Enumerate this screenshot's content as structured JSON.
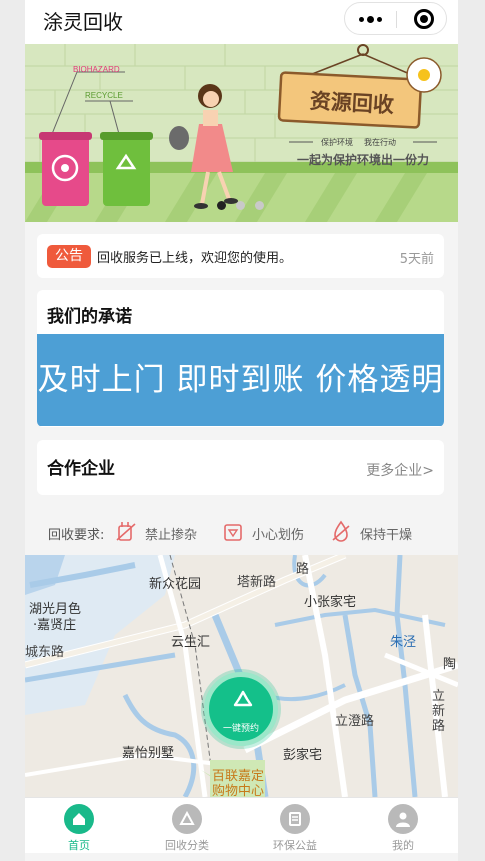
{
  "header": {
    "title": "涂灵回收",
    "menu_icon": "more-dots-icon",
    "close_icon": "capsule-close-icon"
  },
  "banner": {
    "bin_label_1": "BIOHAZARD",
    "bin_label_2": "RECYCLE",
    "sign_title": "资源回收",
    "sign_sub_1": "保护环境",
    "sign_sub_2": "我在行动",
    "slogan": "一起为保护环境出一份力",
    "slides_count": 3,
    "active_slide": 1
  },
  "notice": {
    "badge": "公告",
    "text": "回收服务已上线，欢迎您的使用。",
    "time": "5天前"
  },
  "promise": {
    "title": "我们的承诺",
    "banner_text": "及时上门  即时到账  价格透明"
  },
  "partners": {
    "title": "合作企业",
    "more": "更多企业>"
  },
  "requirements": {
    "label": "回收要求:",
    "items": [
      {
        "text": "禁止掺杂",
        "icon": "no-mix-icon"
      },
      {
        "text": "小心划伤",
        "icon": "cut-warning-icon"
      },
      {
        "text": "保持干燥",
        "icon": "keep-dry-icon"
      }
    ]
  },
  "map": {
    "labels": {
      "xinzhong": "新众花园",
      "tawan": "塔新路",
      "lu": "路",
      "xiaozhang": "小张家宅",
      "huguang1": "湖光月色",
      "huguang2": "·嘉贤庄",
      "yunsheng": "云生汇",
      "zhujing": "朱泾",
      "tao": "陶",
      "chengdong": "城东路",
      "likeng1": "立",
      "likeng2": "新",
      "likeng3": "路",
      "lideng": "立澄路",
      "jiayi": "嘉怡别墅",
      "pengjia": "彭家宅",
      "bailian1": "百联嘉定",
      "bailian2": "购物中心"
    },
    "book_button": "一键预约"
  },
  "tabs": [
    {
      "label": "首页",
      "icon": "home-icon",
      "active": true
    },
    {
      "label": "回收分类",
      "icon": "recycle-category-icon",
      "active": false
    },
    {
      "label": "环保公益",
      "icon": "charity-icon",
      "active": false
    },
    {
      "label": "我的",
      "icon": "profile-icon",
      "active": false
    }
  ],
  "colors": {
    "accent": "#19b98a",
    "notice_badge": "#ef5a3c",
    "promise_banner": "#4d9fd5"
  }
}
